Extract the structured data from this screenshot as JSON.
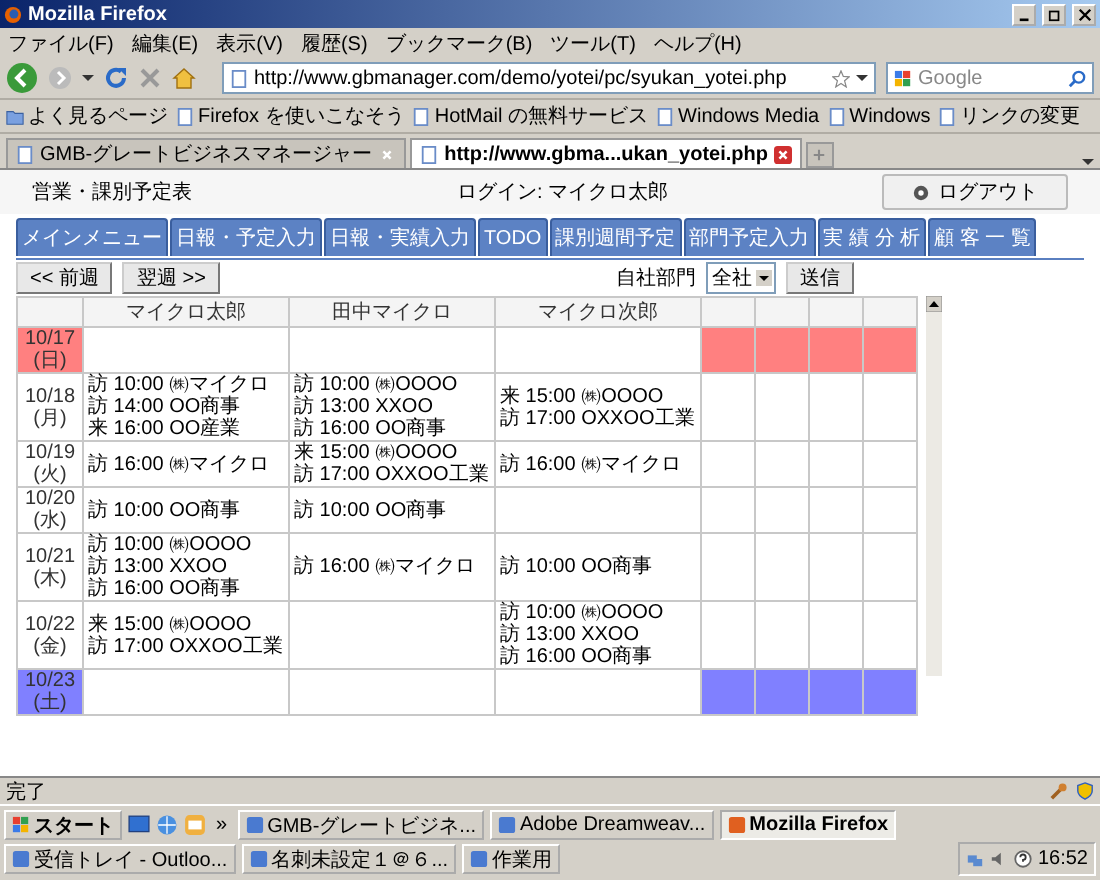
{
  "window": {
    "title": "Mozilla Firefox"
  },
  "menu": [
    "ファイル(F)",
    "編集(E)",
    "表示(V)",
    "履歴(S)",
    "ブックマーク(B)",
    "ツール(T)",
    "ヘルプ(H)"
  ],
  "address": {
    "url": "http://www.gbmanager.com/demo/yotei/pc/syukan_yotei.php"
  },
  "search": {
    "placeholder": "Google"
  },
  "bookmarks": [
    {
      "label": "よく見るページ",
      "kind": "folder"
    },
    {
      "label": "Firefox を使いこなそう",
      "kind": "page"
    },
    {
      "label": "HotMail の無料サービス",
      "kind": "page"
    },
    {
      "label": "Windows Media",
      "kind": "page"
    },
    {
      "label": "Windows",
      "kind": "page"
    },
    {
      "label": "リンクの変更",
      "kind": "page"
    }
  ],
  "tabs": [
    {
      "label": "GMB-グレートビジネスマネージャー",
      "selected": false
    },
    {
      "label": "http://www.gbma...ukan_yotei.php",
      "selected": true
    }
  ],
  "page": {
    "title": "営業・課別予定表",
    "login": "ログイン: マイクロ太郎",
    "logout": "ログアウト",
    "nav": [
      {
        "label": "メインメニュー",
        "selected": false
      },
      {
        "label": "日報・予定入力",
        "selected": false
      },
      {
        "label": "日報・実績入力",
        "selected": false
      },
      {
        "label": "TODO",
        "selected": false
      },
      {
        "label": "課別週間予定",
        "selected": false
      },
      {
        "label": "部門予定入力",
        "selected": false
      },
      {
        "label": "実 績 分 析",
        "selected": false
      },
      {
        "label": "顧 客 一 覧",
        "selected": false
      }
    ],
    "prev": "<< 前週",
    "next": "翌週 >>",
    "dept_label": "自社部門",
    "dept_value": "全社",
    "submit": "送信",
    "table": {
      "columns": [
        "マイクロ太郎",
        "田中マイクロ",
        "マイクロ次郎"
      ],
      "rows": [
        {
          "date": "10/17",
          "weekday": "(日)",
          "kind": "sunday",
          "cells": [
            [],
            [],
            []
          ]
        },
        {
          "date": "10/18",
          "weekday": "(月)",
          "kind": "weekday",
          "cells": [
            [
              "訪 10:00 ㈱マイクロ",
              "訪 14:00 OO商事",
              "来 16:00 OO産業"
            ],
            [
              "訪 10:00 ㈱OOOO",
              "訪 13:00 XXOO",
              "訪 16:00 OO商事"
            ],
            [
              "来 15:00 ㈱OOOO",
              "訪 17:00 OXXOO工業"
            ]
          ]
        },
        {
          "date": "10/19",
          "weekday": "(火)",
          "kind": "weekday",
          "cells": [
            [
              "訪 16:00 ㈱マイクロ"
            ],
            [
              "来 15:00 ㈱OOOO",
              "訪 17:00 OXXOO工業"
            ],
            [
              "訪 16:00 ㈱マイクロ"
            ]
          ]
        },
        {
          "date": "10/20",
          "weekday": "(水)",
          "kind": "weekday",
          "cells": [
            [
              "訪 10:00 OO商事"
            ],
            [
              "訪 10:00 OO商事"
            ],
            []
          ]
        },
        {
          "date": "10/21",
          "weekday": "(木)",
          "kind": "weekday",
          "cells": [
            [
              "訪 10:00 ㈱OOOO",
              "訪 13:00 XXOO",
              "訪 16:00 OO商事"
            ],
            [
              "訪 16:00 ㈱マイクロ"
            ],
            [
              "訪 10:00 OO商事"
            ]
          ]
        },
        {
          "date": "10/22",
          "weekday": "(金)",
          "kind": "weekday",
          "cells": [
            [
              "来 15:00 ㈱OOOO",
              "訪 17:00 OXXOO工業"
            ],
            [],
            [
              "訪 10:00 ㈱OOOO",
              "訪 13:00 XXOO",
              "訪 16:00 OO商事"
            ]
          ]
        },
        {
          "date": "10/23",
          "weekday": "(土)",
          "kind": "saturday",
          "cells": [
            [],
            [],
            []
          ]
        }
      ]
    }
  },
  "status_bar": {
    "text": "完了"
  },
  "taskbar": {
    "start": "スタート",
    "overflow": "»",
    "items": [
      {
        "label": "GMB-グレートビジネ...",
        "selected": false
      },
      {
        "label": "Adobe Dreamweav...",
        "selected": false
      },
      {
        "label": "Mozilla Firefox",
        "selected": true
      },
      {
        "label": "受信トレイ - Outloo...",
        "selected": false
      },
      {
        "label": "名刺未設定１＠６...",
        "selected": false
      },
      {
        "label": "作業用",
        "selected": false
      }
    ],
    "clock": "16:52"
  }
}
